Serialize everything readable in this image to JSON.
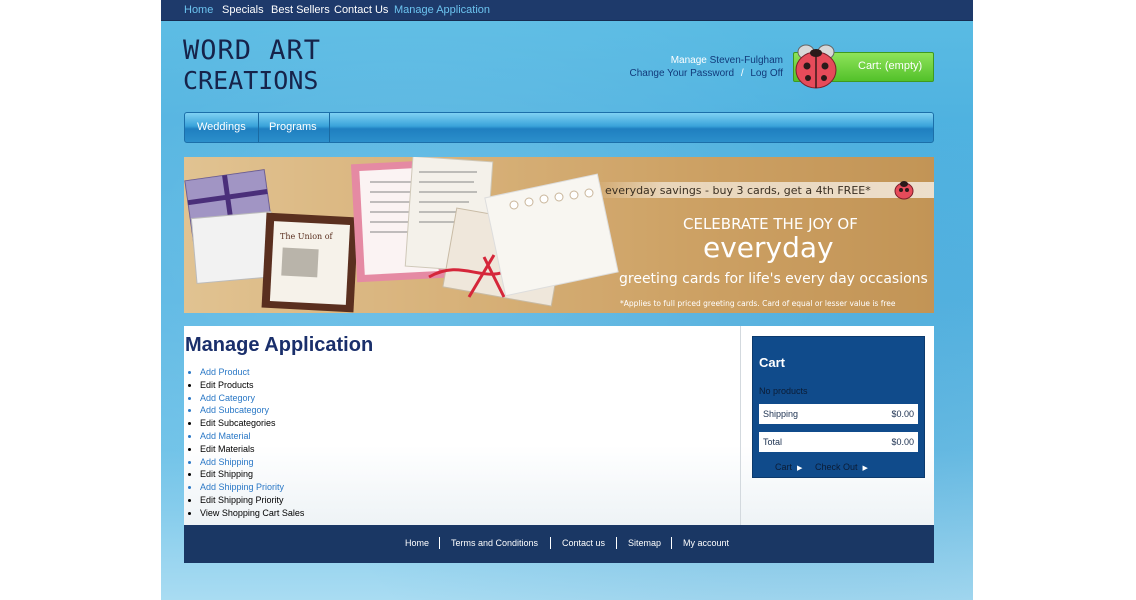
{
  "top_nav": {
    "items": [
      {
        "label": "Home"
      },
      {
        "label": "Specials"
      },
      {
        "label": "Best Sellers"
      },
      {
        "label": "Contact Us"
      },
      {
        "label": "Manage Application"
      }
    ]
  },
  "logo": {
    "line1": "WORD ART",
    "line2": "CREATIONS"
  },
  "account": {
    "manage_label": "Manage",
    "username": "Steven-Fulgham",
    "change_password": "Change Your Password",
    "separator": "/",
    "log_off": "Log Off"
  },
  "cart_button": {
    "label": "Cart: (empty)"
  },
  "main_menu": {
    "items": [
      {
        "label": "Weddings"
      },
      {
        "label": "Programs"
      }
    ]
  },
  "banner": {
    "tagline": "everyday savings - buy 3 cards, get a 4th FREE*",
    "headline1": "CELEBRATE THE JOY OF",
    "headline2": "everyday",
    "subline": "greeting cards for life's every day occasions",
    "footnote": "*Applies to full priced greeting cards. Card of equal or lesser value is free",
    "card_text": "The Union of"
  },
  "page_title": "Manage Application",
  "manage_menu": [
    {
      "label": "Add Product"
    },
    {
      "label": "Edit Products"
    },
    {
      "label": "Add Category"
    },
    {
      "label": "Add Subcategory"
    },
    {
      "label": "Edit Subcategories"
    },
    {
      "label": "Add Material"
    },
    {
      "label": "Edit Materials"
    },
    {
      "label": "Add Shipping"
    },
    {
      "label": "Edit Shipping"
    },
    {
      "label": "Add Shipping Priority"
    },
    {
      "label": "Edit Shipping Priority"
    },
    {
      "label": "View Shopping Cart Sales"
    }
  ],
  "side_cart": {
    "heading": "Cart",
    "empty_text": "No products",
    "shipping_label": "Shipping",
    "shipping_value": "$0.00",
    "total_label": "Total",
    "total_value": "$0.00",
    "cart_button": "Cart",
    "checkout_button": "Check Out"
  },
  "footer": {
    "links": [
      {
        "label": "Home"
      },
      {
        "label": "Terms and Conditions"
      },
      {
        "label": "Contact us"
      },
      {
        "label": "Sitemap"
      },
      {
        "label": "My account"
      }
    ]
  },
  "colors": {
    "nav_bar": "#1e3a6b",
    "active_link": "#6cc3ef",
    "cart_green": "#53c12a",
    "title_navy": "#1a2f6b",
    "link_blue": "#2a78c6",
    "side_cart_bg": "#104b8b",
    "footer_bg": "#1a3764"
  }
}
